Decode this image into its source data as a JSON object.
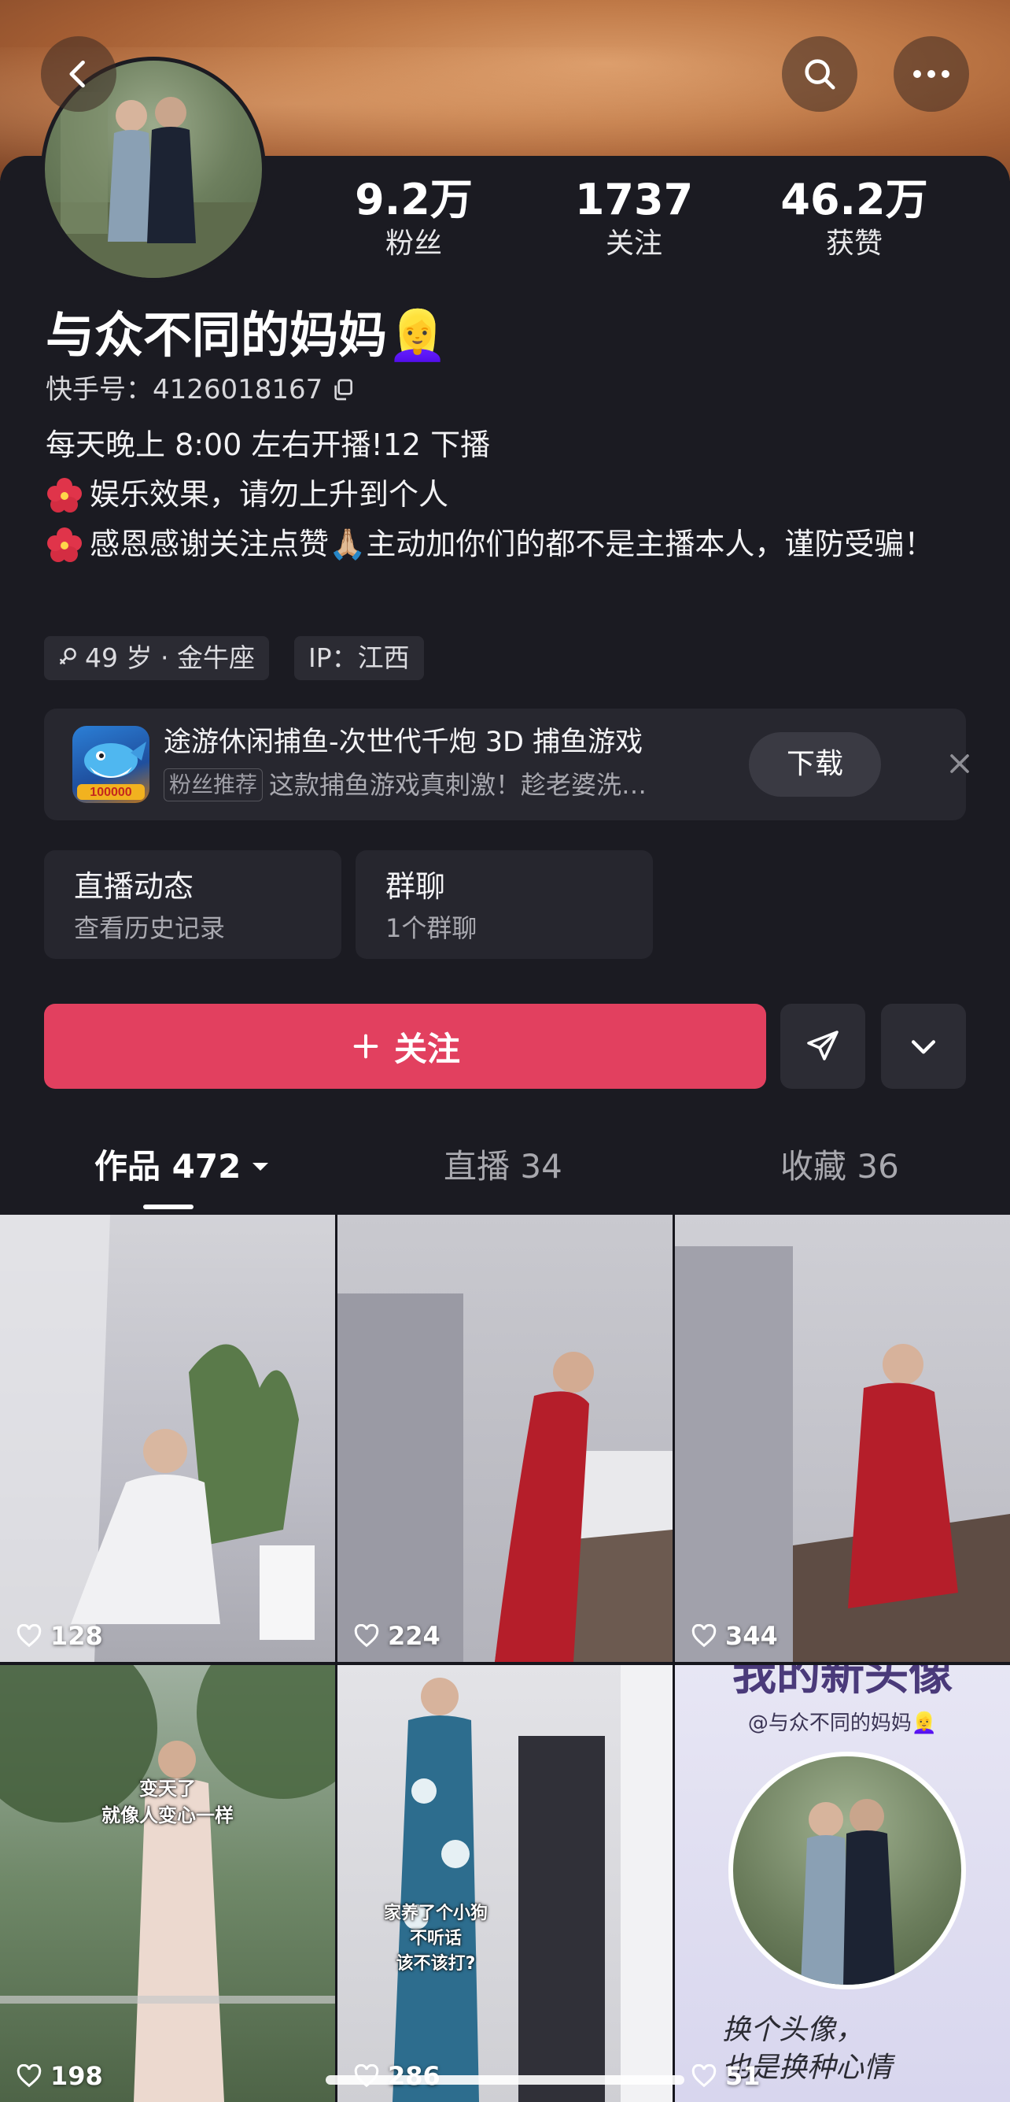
{
  "header": {
    "back_icon": "chevron-left-icon",
    "search_icon": "search-icon",
    "more_icon": "more-dots-icon"
  },
  "profile": {
    "stats": [
      {
        "value": "9.2万",
        "label": "粉丝"
      },
      {
        "value": "1737",
        "label": "关注"
      },
      {
        "value": "46.2万",
        "label": "获赞"
      }
    ],
    "name": "与众不同的妈妈👱‍♀️",
    "uid": "快手号：4126018167",
    "bio": [
      "每天晚上 8:00 左右开播!12 下播",
      "娱乐效果，请勿上升到个人",
      "感恩感谢关注点赞🙏🏼主动加你们的都不是主播本人，谨防受骗！"
    ],
    "tags": [
      "49 岁 · 金牛座",
      "IP：江西"
    ]
  },
  "ad": {
    "title": "途游休闲捕鱼-次世代千炮 3D 捕鱼游戏",
    "badge": "粉丝推荐",
    "subtitle": "这款捕鱼游戏真刺激！趁老婆洗…",
    "icon_number": "100000",
    "download": "下载"
  },
  "cards": [
    {
      "title": "直播动态",
      "sub": "查看历史记录"
    },
    {
      "title": "群聊",
      "sub": "1个群聊"
    }
  ],
  "actions": {
    "follow": "关注",
    "share_icon": "send-icon",
    "expand_icon": "chevron-down-icon"
  },
  "tabs": [
    {
      "label": "作品 472",
      "active": true
    },
    {
      "label": "直播 34",
      "active": false
    },
    {
      "label": "收藏 36",
      "active": false
    }
  ],
  "videos": [
    {
      "likes": "128"
    },
    {
      "likes": "224"
    },
    {
      "likes": "344"
    },
    {
      "likes": "198",
      "caption": "变天了\n就像人变心一样"
    },
    {
      "likes": "286",
      "caption": "家养了个小狗\n不听话\n该不该打?"
    },
    {
      "likes": "51",
      "title": "我的新头像",
      "mention": "@与众不同的妈妈👱‍♀️",
      "handwriting": "换个头像，\n也是换种心情"
    }
  ],
  "colors": {
    "accent": "#e2405f",
    "background": "#1b1b22",
    "card": "#26262e"
  }
}
